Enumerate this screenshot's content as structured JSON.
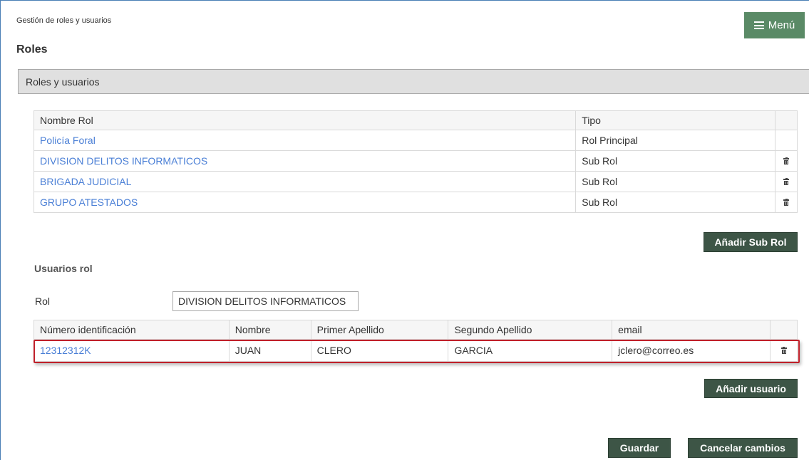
{
  "breadcrumb": "Gestión de roles y usuarios",
  "menu": {
    "label": "Menú"
  },
  "page_title": "Roles",
  "section_title": "Roles y usuarios",
  "roles_table": {
    "headers": {
      "name": "Nombre Rol",
      "type": "Tipo"
    },
    "rows": [
      {
        "name": "Policía Foral",
        "type": "Rol Principal"
      },
      {
        "name": "DIVISION DELITOS INFORMATICOS",
        "type": "Sub Rol"
      },
      {
        "name": "BRIGADA JUDICIAL",
        "type": "Sub Rol"
      },
      {
        "name": "GRUPO ATESTADOS",
        "type": "Sub Rol"
      }
    ]
  },
  "add_subrole_label": "Añadir Sub Rol",
  "users_section": {
    "title": "Usuarios rol",
    "role_label": "Rol",
    "role_value": "DIVISION DELITOS INFORMATICOS"
  },
  "users_table": {
    "headers": {
      "id": "Número identificación",
      "name": "Nombre",
      "surname1": "Primer Apellido",
      "surname2": "Segundo Apellido",
      "email": "email"
    },
    "rows": [
      {
        "id": "12312312K",
        "name": "JUAN",
        "surname1": "CLERO",
        "surname2": "GARCIA",
        "email": "jclero@correo.es"
      }
    ]
  },
  "add_user_label": "Añadir usuario",
  "save_label": "Guardar",
  "cancel_label": "Cancelar cambios",
  "colors": {
    "menu_button": "#5a8a66",
    "dark_button": "#3d5546",
    "link": "#4a7fd6",
    "highlight_border": "#c0202a"
  },
  "icons": {
    "menu": "hamburger-icon",
    "delete": "trash-icon"
  }
}
